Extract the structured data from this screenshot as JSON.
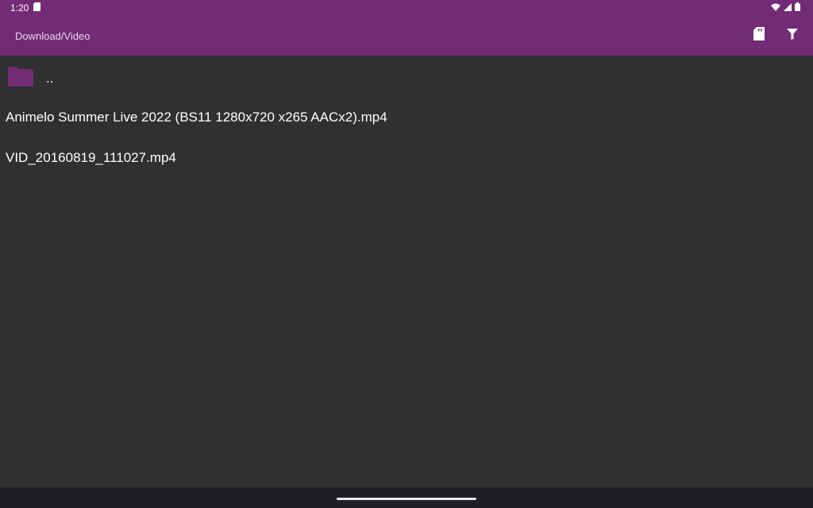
{
  "status": {
    "time": "1:20",
    "icons": [
      "sd-card-icon",
      "wifi-icon",
      "signal-icon",
      "battery-icon"
    ]
  },
  "app_bar": {
    "path": "Download/Video",
    "actions": [
      "sd-card-icon",
      "filter-icon"
    ],
    "accent_color": "#722b75"
  },
  "files": {
    "parent": "..",
    "items": [
      "Animelo Summer Live 2022 (BS11 1280x720 x265 AACx2).mp4",
      "VID_20160819_111027.mp4"
    ]
  },
  "colors": {
    "background": "#303030",
    "folder": "#722b75",
    "nav_bar": "#1f2023"
  }
}
